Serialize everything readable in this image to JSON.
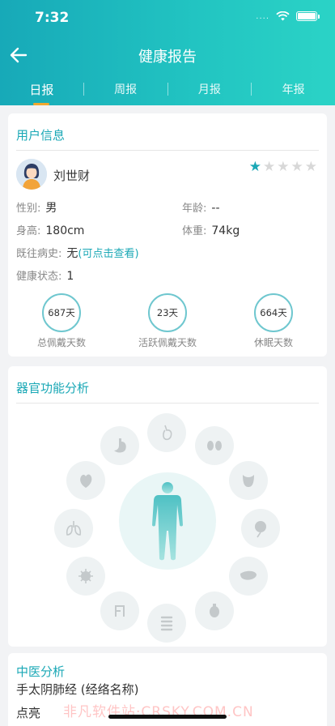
{
  "status": {
    "time": "7:32",
    "signal": "....",
    "wifi_icon": "wifi-icon",
    "battery_icon": "battery-icon"
  },
  "nav": {
    "title": "健康报告",
    "back_icon": "arrow-left-icon"
  },
  "tabs": [
    {
      "label": "日报",
      "active": true
    },
    {
      "label": "周报",
      "active": false
    },
    {
      "label": "月报",
      "active": false
    },
    {
      "label": "年报",
      "active": false
    }
  ],
  "user_card": {
    "title": "用户信息",
    "name": "刘世财",
    "rating": 1,
    "rating_max": 5,
    "gender_label": "性别:",
    "gender": "男",
    "age_label": "年龄:",
    "age": "--",
    "height_label": "身高:",
    "height": "180cm",
    "weight_label": "体重:",
    "weight": "74kg",
    "history_label": "既往病史:",
    "history": "无",
    "history_link": "(可点击查看)",
    "health_label": "健康状态:",
    "health": "1",
    "stats": [
      {
        "value": "687天",
        "label": "总佩戴天数"
      },
      {
        "value": "23天",
        "label": "活跃佩戴天数"
      },
      {
        "value": "664天",
        "label": "休眠天数"
      }
    ]
  },
  "organ_card": {
    "title": "器官功能分析",
    "organs": [
      "liver-icon",
      "kidney-icon",
      "bladder-icon",
      "pancreas-icon",
      "liver-right-icon",
      "stomach-small-icon",
      "intestine-icon",
      "small-intestine-icon",
      "bacteria-icon",
      "lungs-icon",
      "heart-icon",
      "stomach-icon"
    ],
    "body_icon": "human-body-icon",
    "accent": "#1aa8b6"
  },
  "tcm_card": {
    "title": "中医分析",
    "line1": "手太阴肺经   (经络名称)",
    "line2_partial": "点亮"
  },
  "watermark": "非凡软件站·CRSKY.COM.CN"
}
